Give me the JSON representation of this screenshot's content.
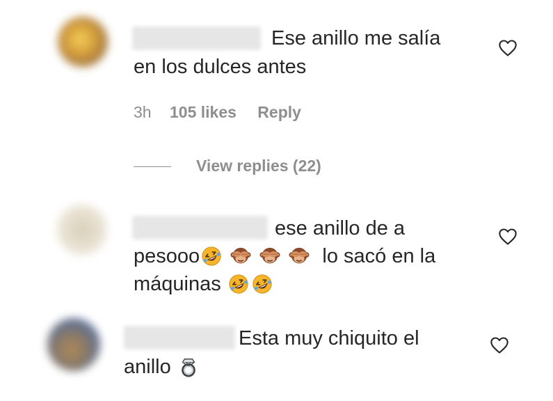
{
  "comments": [
    {
      "line1": "Ese anillo me salía",
      "line2": "en los dulces antes",
      "time": "3h",
      "likes": "105 likes",
      "reply": "Reply",
      "view_replies": "View replies (22)"
    },
    {
      "line1": "ese anillo de a",
      "line2_a": "pesooo",
      "line2_b": "lo sacó en la",
      "line3": "máquinas"
    },
    {
      "line1": "Esta muy chiquito el",
      "line2": "anillo"
    }
  ],
  "icons": {
    "heart": "heart-icon",
    "laugh": "rolling-on-floor-laughing-emoji",
    "monkey": "see-no-evil-monkey-emoji",
    "ring": "ring-emoji"
  },
  "colors": {
    "text": "#262626",
    "meta": "#8e8e8e",
    "emoji_yellow": "#f7b52c",
    "monkey_brown": "#8a4a2b"
  }
}
